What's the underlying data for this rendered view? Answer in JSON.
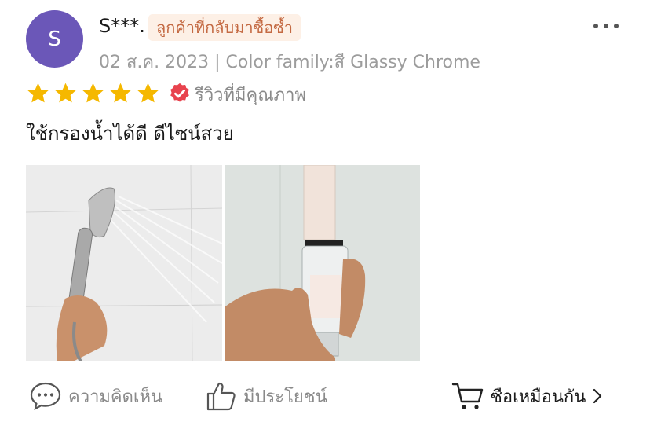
{
  "reviewer": {
    "avatar_letter": "S",
    "avatar_color": "#6b57b8",
    "name": "S***.",
    "badge": "ลูกค้าที่กลับมาซื้อซ้ำ",
    "meta": "02 ส.ค. 2023 | Color family:สี Glassy Chrome"
  },
  "rating": {
    "stars": 5,
    "max": 5,
    "verified_label": "รีวิวที่มีคุณภาพ"
  },
  "review_text": "ใช้กรองน้ำได้ดี ดีไซน์สวย",
  "photos": [
    {
      "name": "shower-head-photo"
    },
    {
      "name": "filter-cartridge-photo"
    }
  ],
  "actions": {
    "comment_label": "ความคิดเห็น",
    "helpful_label": "มีประโยชน์",
    "buy_label": "ซือเหมือนกัน"
  },
  "icons": [
    "more-icon",
    "star-icon",
    "verified-icon",
    "comment-icon",
    "thumbs-up-icon",
    "cart-icon",
    "chevron-right-icon"
  ],
  "colors": {
    "star": "#f5b800",
    "verified": "#e8434e",
    "badge_bg": "#fdf0e6",
    "badge_text": "#c46a43"
  }
}
